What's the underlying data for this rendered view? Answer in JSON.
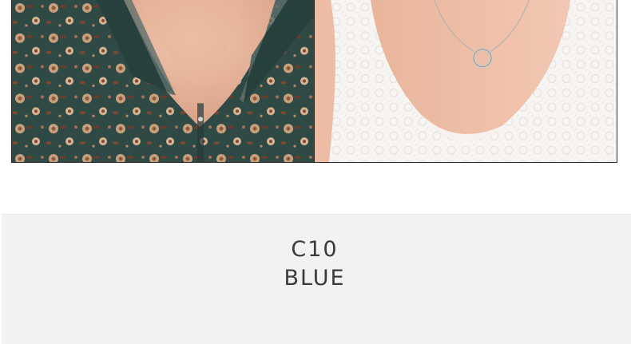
{
  "photos": [
    {
      "name": "photo-floral-shirt",
      "icon": "floral-shirt-collar-photo",
      "colors": {
        "base": "#2f4a45",
        "flower": "#c9a07e",
        "leaf": "#6b3c2e",
        "skin": "#e8b9a1"
      }
    },
    {
      "name": "photo-lace-top",
      "icon": "lace-top-necklace-photo",
      "colors": {
        "base": "#f4f1ee",
        "skin": "#f0c3ae",
        "lace": "#ffffff"
      }
    }
  ],
  "variant": {
    "code": "C10",
    "color_name": "BLUE"
  },
  "theme": {
    "panel_bg": "#f2f2f2",
    "text_color": "#3a3a3a"
  }
}
